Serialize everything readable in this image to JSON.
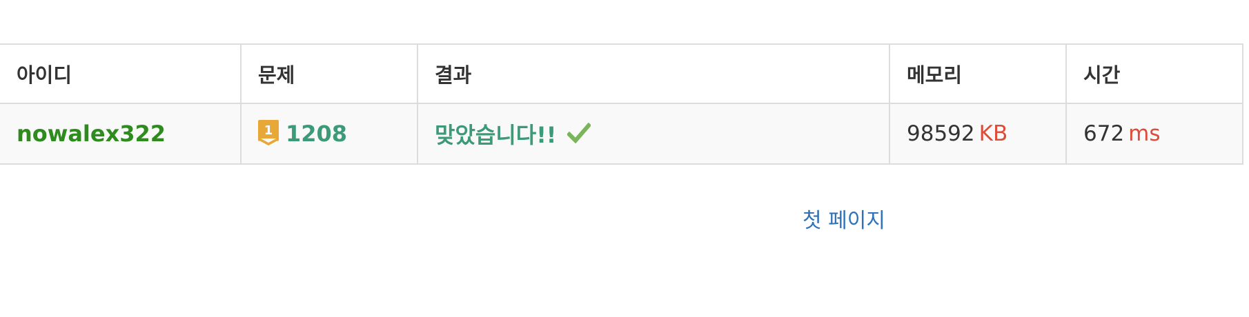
{
  "table": {
    "headers": {
      "id": "아이디",
      "problem": "문제",
      "result": "결과",
      "memory": "메모리",
      "time": "시간"
    },
    "rows": [
      {
        "user": "nowalex322",
        "problem_tier_icon": "tier-badge-icon",
        "problem_tier": "1",
        "problem_id": "1208",
        "result": "맞았습니다!!",
        "result_icon": "check-icon",
        "memory_value": "98592",
        "memory_unit": "KB",
        "time_value": "672",
        "time_unit": "ms"
      }
    ]
  },
  "pagination": {
    "first_page_label": "첫 페이지"
  },
  "colors": {
    "user": "#2e8b1e",
    "problem": "#3c9a78",
    "result": "#3c9a78",
    "unit": "#dd4b39",
    "link": "#2f72b8",
    "tier_badge": "#e8a838"
  }
}
